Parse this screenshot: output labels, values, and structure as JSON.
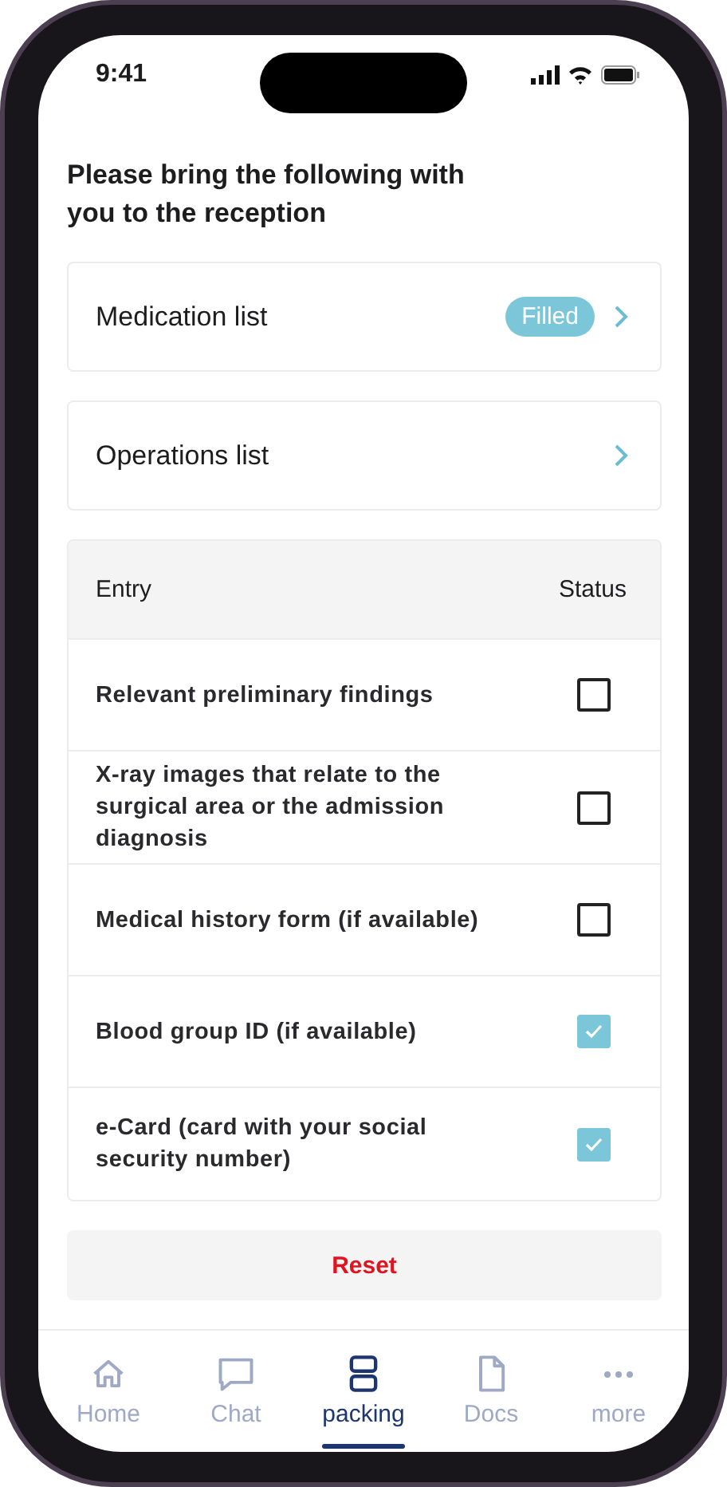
{
  "status_bar": {
    "time": "9:41"
  },
  "title": "Please bring the following with you to the reception",
  "links": [
    {
      "label": "Medication list",
      "badge": "Filled"
    },
    {
      "label": "Operations list"
    }
  ],
  "table": {
    "columns": [
      "Entry",
      "Status"
    ],
    "rows": [
      {
        "entry": "Relevant preliminary findings",
        "checked": false
      },
      {
        "entry": "X-ray images that relate to the surgical area or the admission diagnosis",
        "checked": false
      },
      {
        "entry": "Medical history form (if available)",
        "checked": false
      },
      {
        "entry": "Blood group ID (if available)",
        "checked": true
      },
      {
        "entry": "e-Card (card with your social security number)",
        "checked": true
      }
    ]
  },
  "reset_button": "Reset",
  "tabs": [
    {
      "kind": "home",
      "label": "Home",
      "selected": false
    },
    {
      "kind": "chat",
      "label": "Chat",
      "selected": false
    },
    {
      "kind": "packing",
      "label": "packing",
      "selected": true
    },
    {
      "kind": "docs",
      "label": "Docs",
      "selected": false
    },
    {
      "kind": "more",
      "label": "more",
      "selected": false
    }
  ]
}
